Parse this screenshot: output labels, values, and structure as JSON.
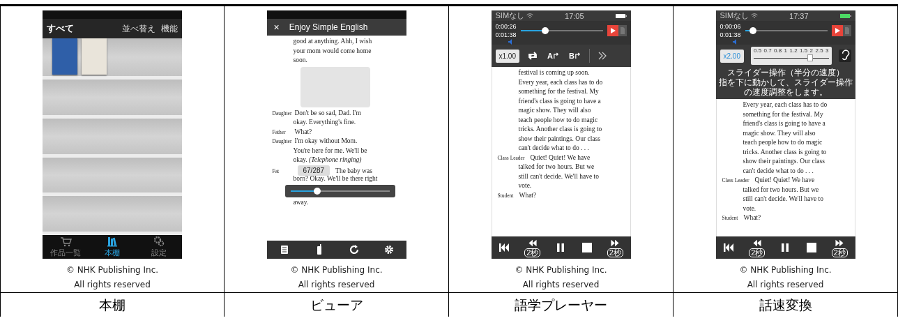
{
  "columns": [
    {
      "screen": {
        "kind": "bookshelf",
        "header": {
          "title": "すべて",
          "actions": [
            "並べ替え",
            "機能"
          ]
        },
        "books": [
          {
            "color": "#2f5fa8"
          },
          {
            "color": "#e9e4da"
          }
        ],
        "tabs": [
          {
            "label": "作品一覧",
            "selected": false
          },
          {
            "label": "本棚",
            "selected": true
          },
          {
            "label": "設定",
            "selected": false
          }
        ]
      },
      "copyright": "© NHK Publishing Inc.",
      "rights": "All rights reserved",
      "title": "本棚"
    },
    {
      "screen": {
        "kind": "viewer",
        "close": "×",
        "title": "Enjoy Simple English",
        "lines": [
          {
            "kind": "text",
            "text": "good at anything. Ahh, I wish"
          },
          {
            "kind": "text",
            "text": "your mom would come home"
          },
          {
            "kind": "text",
            "text": "soon."
          },
          {
            "kind": "illustration"
          },
          {
            "kind": "speaker",
            "speaker": "Daughter",
            "text": "Don't be so sad, Dad. I'm"
          },
          {
            "kind": "text",
            "text": "okay. Everything's fine."
          },
          {
            "kind": "speaker",
            "speaker": "Father",
            "text": "What?"
          },
          {
            "kind": "speaker",
            "speaker": "Daughter",
            "text": "I'm okay without Mom."
          },
          {
            "kind": "text",
            "text": "You're here for me. We'll be"
          },
          {
            "kind": "text",
            "text": "okay. *(Telephone ringing)*"
          },
          {
            "kind": "popup_row",
            "speaker": "Fat",
            "popup": "67/287",
            "text": "The baby was"
          },
          {
            "kind": "text",
            "text": "born? Okay. We'll be there right"
          },
          {
            "kind": "slider",
            "level": 0.27
          },
          {
            "kind": "text",
            "text": "away."
          }
        ]
      },
      "copyright": "© NHK Publishing Inc.",
      "rights": "All rights reserved",
      "title": "ビューア"
    },
    {
      "screen": {
        "kind": "player",
        "carrier": "SIMなし",
        "time": "17:05",
        "elapsed": "0:00:26",
        "total": "0:01:38",
        "level": 0.3,
        "speed": {
          "label": "x1.00",
          "highlighted": false
        },
        "loop_points": [
          "A",
          "B"
        ],
        "lines": [
          {
            "kind": "text",
            "text": "festival is coming up soon."
          },
          {
            "kind": "text",
            "text": "Every year, each class has to do"
          },
          {
            "kind": "text",
            "text": "something for the festival. My"
          },
          {
            "kind": "text",
            "text": "friend's class is going to have a"
          },
          {
            "kind": "text",
            "text": "magic show. They will also"
          },
          {
            "kind": "text",
            "text": "teach people how to do magic"
          },
          {
            "kind": "text",
            "text": "tricks. Another class is going to"
          },
          {
            "kind": "text",
            "text": "show their paintings. Our class"
          },
          {
            "kind": "text",
            "text": "can't decide what to do . . ."
          },
          {
            "kind": "speaker",
            "speaker": "Class Leader",
            "text": "Quiet! Quiet! We have"
          },
          {
            "kind": "text",
            "text": "talked for two hours. But we"
          },
          {
            "kind": "text",
            "text": "still can't decide. We'll have to"
          },
          {
            "kind": "text",
            "text": "vote."
          },
          {
            "kind": "speaker",
            "speaker": "Student",
            "text": "What?"
          }
        ],
        "controls": {
          "rewind_badge": "2秒",
          "forward_badge": "2秒"
        }
      },
      "copyright": "© NHK Publishing Inc.",
      "rights": "All rights reserved",
      "title": "語学プレーヤー"
    },
    {
      "screen": {
        "kind": "speed",
        "carrier": "SIMなし",
        "time": "17:37",
        "elapsed": "0:00:06",
        "total": "0:01:38",
        "level": 0.1,
        "speed": {
          "label": "x2.00",
          "highlighted": true
        },
        "speed_slider": {
          "ticks": [
            "0.5",
            "0.7",
            "0.8",
            "1",
            "1.2",
            "1.5",
            "2",
            "2.5",
            "3"
          ],
          "level": 0.75
        },
        "hints": [
          "スライダー操作（半分の速度）",
          "指を下に動かして、スライダー操作の速度調整をします。"
        ],
        "lines": [
          {
            "kind": "text",
            "text": "Every year, each class has to do"
          },
          {
            "kind": "text",
            "text": "something for the festival. My"
          },
          {
            "kind": "text",
            "text": "friend's class is going to have a"
          },
          {
            "kind": "text",
            "text": "magic show. They will also"
          },
          {
            "kind": "text",
            "text": "teach people how to do magic"
          },
          {
            "kind": "text",
            "text": "tricks. Another class is going to"
          },
          {
            "kind": "text",
            "text": "show their paintings. Our class"
          },
          {
            "kind": "text",
            "text": "can't decide what to do . . ."
          },
          {
            "kind": "speaker",
            "speaker": "Class Leader",
            "text": "Quiet! Quiet! We have"
          },
          {
            "kind": "text",
            "text": "talked for two hours. But we"
          },
          {
            "kind": "text",
            "text": "still can't decide. We'll have to"
          },
          {
            "kind": "text",
            "text": "vote."
          },
          {
            "kind": "speaker",
            "speaker": "Student",
            "text": "What?"
          }
        ],
        "controls": {
          "rewind_badge": "2秒",
          "forward_badge": "2秒"
        }
      },
      "copyright": "© NHK Publishing Inc.",
      "rights": "All rights reserved",
      "title": "話速変換"
    }
  ]
}
